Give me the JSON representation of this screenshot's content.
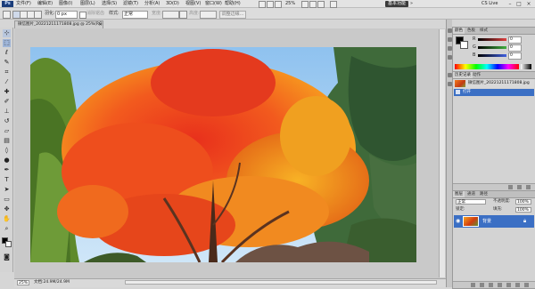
{
  "app": {
    "logo": "Ps",
    "workspace": "基本功能",
    "cs_live": "CS Live"
  },
  "menu": [
    "文件(F)",
    "编辑(E)",
    "图像(I)",
    "图层(L)",
    "选择(S)",
    "滤镜(T)",
    "分析(A)",
    "3D(D)",
    "视图(V)",
    "窗口(W)",
    "帮助(H)"
  ],
  "menu_zoom": "25%",
  "options": {
    "feather_label": "羽化:",
    "feather_value": "0 px",
    "antialias_label": "消除锯齿",
    "style_label": "样式:",
    "style_value": "正常",
    "width_label": "宽度:",
    "height_label": "高度:",
    "refine_edge": "调整边缘..."
  },
  "document": {
    "tab_title": "微信图片_20221211171808.jpg @ 25%(RGB/8)",
    "zoom": "25%",
    "doc_info": "文档:24.9M/24.9M"
  },
  "color_panel": {
    "tabs": [
      "颜色",
      "色板",
      "样式"
    ],
    "sliders": [
      {
        "label": "R",
        "value": "0",
        "color": "#e04040"
      },
      {
        "label": "G",
        "value": "0",
        "color": "#40b040"
      },
      {
        "label": "B",
        "value": "0",
        "color": "#4060e0"
      }
    ]
  },
  "history_panel": {
    "tabs": [
      "历史记录",
      "动作"
    ],
    "snapshot": "微信图片_20221211171808.jpg",
    "step": "打开"
  },
  "layers_panel": {
    "tabs": [
      "图层",
      "通道",
      "路径"
    ],
    "blend_mode": "正常",
    "opacity_label": "不透明度:",
    "opacity": "100%",
    "lock_label": "锁定:",
    "fill_label": "填充:",
    "fill": "100%",
    "layer_name": "背景"
  },
  "colors": {
    "accent": "#3b6fc4",
    "background": "#d6d6d6"
  }
}
